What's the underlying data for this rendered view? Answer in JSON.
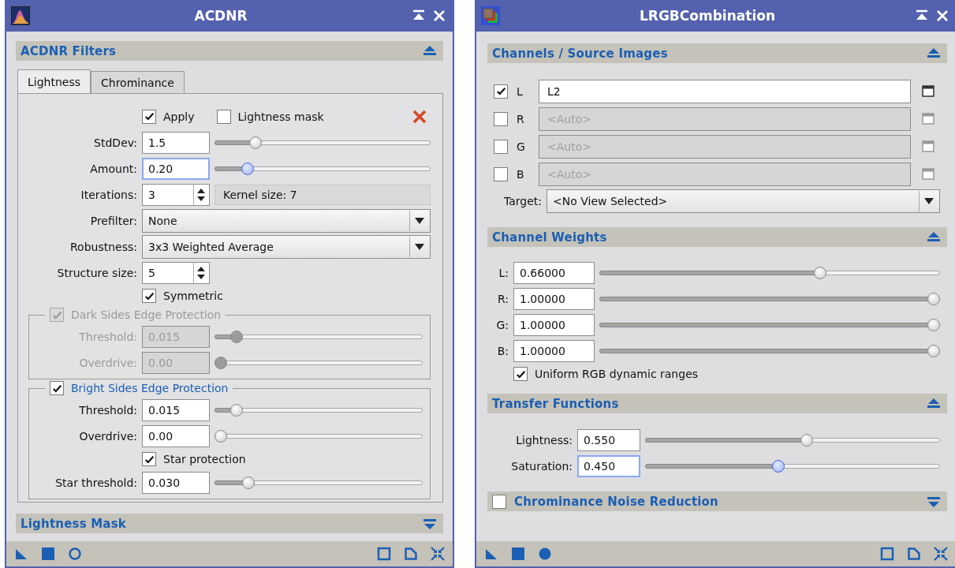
{
  "windows": [
    {
      "title": "ACDNR",
      "sections": [
        {
          "title": "ACDNR Filters",
          "expanded": true,
          "tabs": [
            {
              "label": "Lightness",
              "selected": true
            },
            {
              "label": "Chrominance",
              "selected": false
            }
          ],
          "rows": [
            {
              "kind": "checks",
              "items": [
                {
                  "label": "Apply",
                  "checked": true
                },
                {
                  "label": "Lightness mask",
                  "checked": false
                }
              ]
            },
            {
              "kind": "slider",
              "label": "StdDev:",
              "value": "1.5",
              "level": 0.17,
              "focused": false
            },
            {
              "kind": "slider",
              "label": "Amount:",
              "value": "0.20",
              "level": 0.13,
              "focused": true
            },
            {
              "kind": "spin",
              "label": "Iterations:",
              "value": "3",
              "info": "Kernel size: 7"
            },
            {
              "kind": "combo",
              "label": "Prefilter:",
              "value": "None"
            },
            {
              "kind": "combo",
              "label": "Robustness:",
              "value": "3x3 Weighted Average"
            },
            {
              "kind": "spin",
              "label": "Structure size:",
              "value": "5"
            },
            {
              "kind": "check",
              "label": "Symmetric",
              "checked": true
            },
            {
              "kind": "group",
              "title": "Dark Sides Edge Protection",
              "checked": true,
              "disabled": true,
              "rows": [
                {
                  "kind": "slider",
                  "label": "Threshold:",
                  "value": "0.015",
                  "level": 0.08,
                  "focused": false
                },
                {
                  "kind": "slider",
                  "label": "Overdrive:",
                  "value": "0.00",
                  "level": 0,
                  "focused": false
                }
              ]
            },
            {
              "kind": "group",
              "title": "Bright Sides Edge Protection",
              "checked": true,
              "disabled": false,
              "rows": [
                {
                  "kind": "slider",
                  "label": "Threshold:",
                  "value": "0.015",
                  "level": 0.08,
                  "focused": false
                },
                {
                  "kind": "slider",
                  "label": "Overdrive:",
                  "value": "0.00",
                  "level": 0,
                  "focused": false
                },
                {
                  "kind": "check",
                  "label": "Star protection",
                  "checked": true
                },
                {
                  "kind": "slider",
                  "label": "Star threshold:",
                  "value": "0.030",
                  "level": 0.14,
                  "focused": false
                }
              ]
            }
          ]
        },
        {
          "title": "Lightness Mask",
          "expanded": false
        }
      ]
    },
    {
      "title": "LRGBCombination",
      "sections": [
        {
          "title": "Channels / Source Images",
          "expanded": true,
          "rows": [
            {
              "kind": "channel",
              "label": "L",
              "checked": true,
              "value": "L2"
            },
            {
              "kind": "channel",
              "label": "R",
              "checked": false,
              "placeholder": "<Auto>"
            },
            {
              "kind": "channel",
              "label": "G",
              "checked": false,
              "placeholder": "<Auto>"
            },
            {
              "kind": "channel",
              "label": "B",
              "checked": false,
              "placeholder": "<Auto>"
            },
            {
              "kind": "combo",
              "label": "Target:",
              "value": "<No View Selected>"
            }
          ]
        },
        {
          "title": "Channel Weights",
          "expanded": true,
          "rows": [
            {
              "kind": "slider",
              "label": "L:",
              "value": "0.66000",
              "level": 0.655,
              "focused": false
            },
            {
              "kind": "slider",
              "label": "R:",
              "value": "1.00000",
              "level": 1,
              "focused": false
            },
            {
              "kind": "slider",
              "label": "G:",
              "value": "1.00000",
              "level": 1,
              "focused": false
            },
            {
              "kind": "slider",
              "label": "B:",
              "value": "1.00000",
              "level": 1,
              "focused": false
            },
            {
              "kind": "check",
              "label": "Uniform RGB dynamic ranges",
              "checked": true
            }
          ]
        },
        {
          "title": "Transfer Functions",
          "expanded": true,
          "rows": [
            {
              "kind": "slider",
              "label": "Lightness:",
              "value": "0.550",
              "level": 0.55,
              "focused": false
            },
            {
              "kind": "slider",
              "label": "Saturation:",
              "value": "0.450",
              "level": 0.45,
              "focused": true
            }
          ]
        },
        {
          "title": "Chrominance Noise Reduction",
          "expanded": false,
          "checked": false
        }
      ]
    }
  ]
}
